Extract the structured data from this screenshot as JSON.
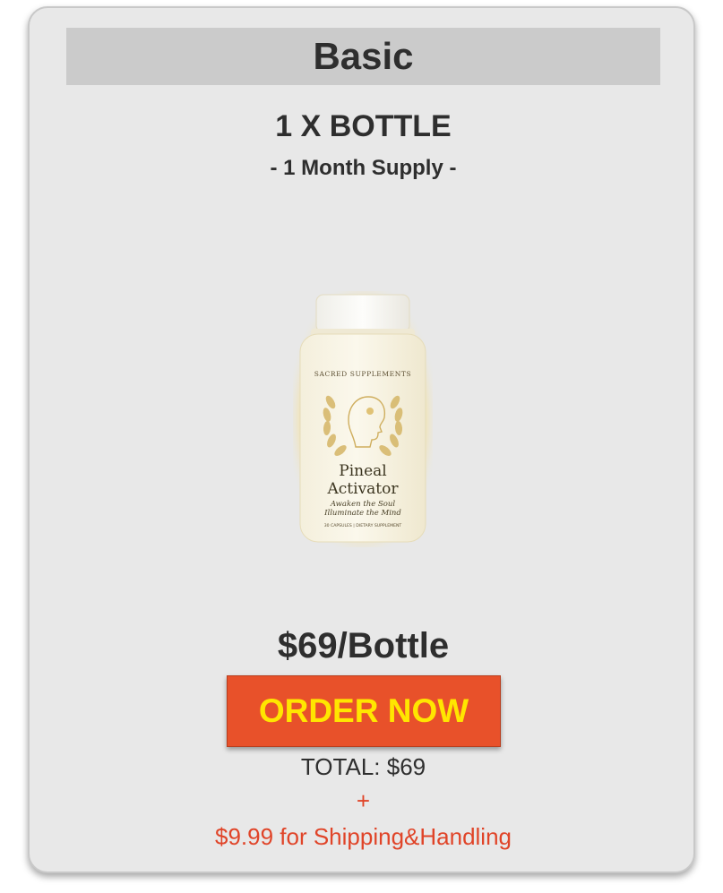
{
  "plan": {
    "title": "Basic"
  },
  "product": {
    "quantity_title": "1 X BOTTLE",
    "supply": "- 1 Month Supply -",
    "label": {
      "brand": "SACRED SUPPLEMENTS",
      "name_line1": "Pineal",
      "name_line2": "Activator",
      "tagline_line1": "Awaken the Soul",
      "tagline_line2": "Illuminate the Mind",
      "footer": "30 CAPSULES | DIETARY SUPPLEMENT"
    }
  },
  "pricing": {
    "price": "$69/Bottle",
    "order_label": "ORDER NOW",
    "total": "TOTAL: $69",
    "plus": "+",
    "shipping": "$9.99 for Shipping&Handling"
  },
  "colors": {
    "card_bg": "#e8e8e8",
    "header_bg": "#cbcbcb",
    "button_bg": "#e8512a",
    "button_text": "#ffe600",
    "accent_red": "#e04428"
  }
}
